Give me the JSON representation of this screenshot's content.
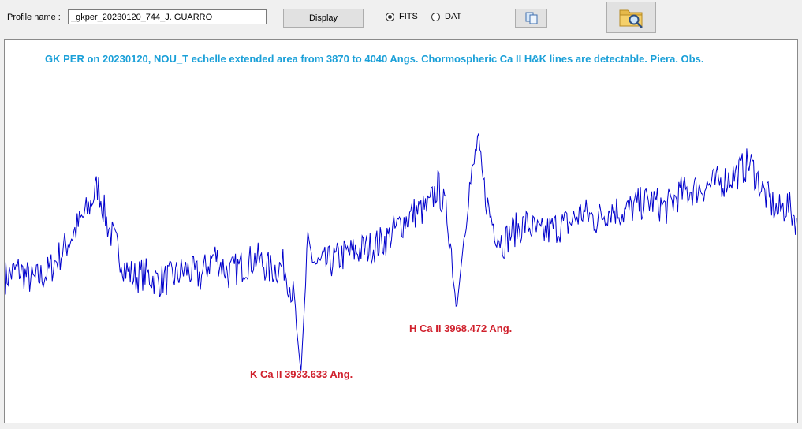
{
  "toolbar": {
    "profile_label": "Profile name :",
    "profile_value": "_gkper_20230120_744_J. GUARRO",
    "display_label": "Display",
    "format_options": [
      {
        "label": "FITS",
        "selected": true
      },
      {
        "label": "DAT",
        "selected": false
      }
    ],
    "copy_icon": "copy-icon",
    "open_icon": "folder-search-icon"
  },
  "plot": {
    "title": "GK PER on 20230120, NOU_T echelle extended area from 3870 to 4040 Angs. Chormospheric Ca II  H&K lines are detectable.  Piera. Obs.",
    "annotations": {
      "h_line": "H Ca II  3968.472 Ang.",
      "k_line": "K Ca II  3933.633 Ang."
    }
  },
  "chart_data": {
    "type": "line",
    "title": "GK PER on 20230120, NOU_T echelle extended area from 3870 to 4040 Angs. Chormospheric Ca II  H&K lines are detectable.  Piera. Obs.",
    "xlabel": "",
    "ylabel": "",
    "xlim": [
      3870,
      4040
    ],
    "ylim": [
      0,
      1
    ],
    "grid": false,
    "color": "#0000cc",
    "series": [
      {
        "x": [
          3870,
          3873,
          3876,
          3879,
          3882,
          3885,
          3888,
          3890,
          3892,
          3894,
          3896,
          3898,
          3900,
          3903,
          3906,
          3909,
          3912,
          3915,
          3918,
          3921,
          3924,
          3927,
          3930,
          3932,
          3933.6,
          3935,
          3937,
          3940,
          3943,
          3946,
          3949,
          3952,
          3955,
          3958,
          3961,
          3963,
          3965,
          3966,
          3967,
          3968.5,
          3969.5,
          3970.5,
          3971.5,
          3972.5,
          3974,
          3975.5,
          3977,
          3979,
          3982,
          3985,
          3988,
          3991,
          3994,
          3997,
          4000,
          4003,
          4006,
          4009,
          4012,
          4015,
          4018,
          4021,
          4024,
          4027,
          4030,
          4033,
          4036,
          4038,
          4040
        ],
        "y": [
          0.38,
          0.4,
          0.37,
          0.39,
          0.44,
          0.5,
          0.56,
          0.62,
          0.52,
          0.46,
          0.4,
          0.38,
          0.39,
          0.37,
          0.38,
          0.4,
          0.38,
          0.44,
          0.39,
          0.41,
          0.43,
          0.4,
          0.41,
          0.33,
          0.13,
          0.46,
          0.41,
          0.42,
          0.44,
          0.45,
          0.46,
          0.48,
          0.52,
          0.55,
          0.56,
          0.62,
          0.54,
          0.44,
          0.29,
          0.47,
          0.6,
          0.65,
          0.74,
          0.64,
          0.55,
          0.5,
          0.47,
          0.5,
          0.52,
          0.49,
          0.51,
          0.52,
          0.55,
          0.53,
          0.56,
          0.55,
          0.57,
          0.58,
          0.56,
          0.6,
          0.61,
          0.62,
          0.63,
          0.65,
          0.68,
          0.6,
          0.55,
          0.57,
          0.53
        ]
      }
    ],
    "annotations": [
      {
        "x": 3968.472,
        "text": "H Ca II  3968.472 Ang."
      },
      {
        "x": 3933.633,
        "text": "K Ca II  3933.633 Ang."
      }
    ]
  }
}
